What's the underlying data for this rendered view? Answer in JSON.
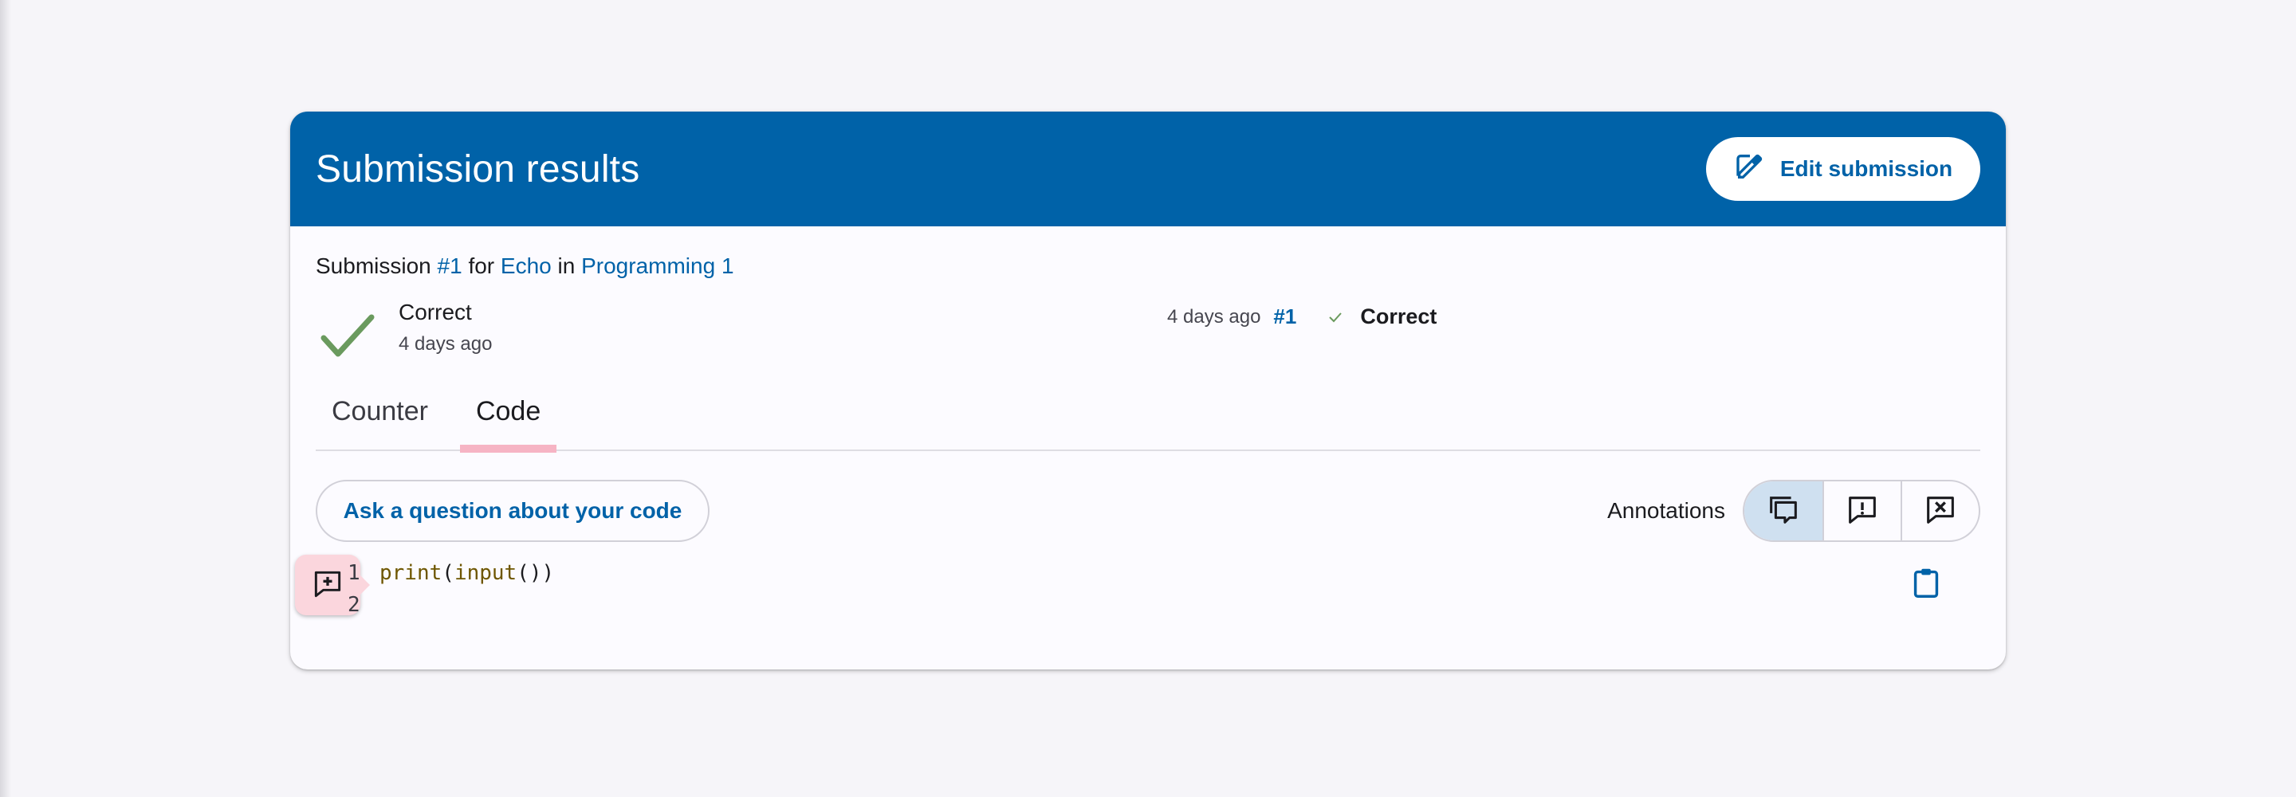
{
  "colors": {
    "brand": "#0062a8",
    "success": "#6a9a5e",
    "tab_indicator": "#f6b4c4",
    "annotation_add": "#fbd6dd"
  },
  "header": {
    "title": "Submission results",
    "edit_label": "Edit submission"
  },
  "submission": {
    "prefix": "Submission",
    "number": "#1",
    "for": "for",
    "exercise": "Echo",
    "in": "in",
    "course": "Programming 1"
  },
  "status": {
    "label": "Correct",
    "time": "4 days ago"
  },
  "history": {
    "time": "4 days ago",
    "number": "#1",
    "result": "Correct"
  },
  "tabs": [
    {
      "label": "Counter"
    },
    {
      "label": "Code"
    }
  ],
  "actions": {
    "ask_label": "Ask a question about your code"
  },
  "annotations": {
    "label": "Annotations",
    "modes": [
      "show-all-icon",
      "show-important-icon",
      "hide-all-icon"
    ]
  },
  "code": {
    "lines": [
      {
        "number": "1",
        "fn1": "print",
        "p1": "(",
        "fn2": "input",
        "p2": "())"
      },
      {
        "number": "2"
      }
    ]
  }
}
